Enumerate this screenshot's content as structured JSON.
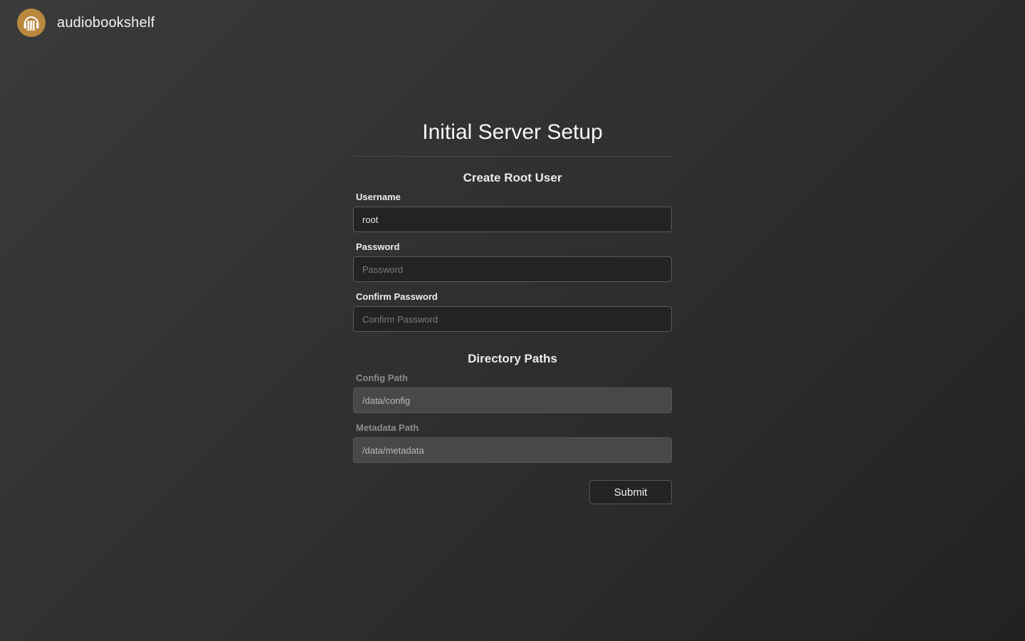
{
  "app": {
    "name": "audiobookshelf",
    "logo_icon": "audiobookshelf-logo-icon",
    "logo_color": "#b9873e"
  },
  "page": {
    "title": "Initial Server Setup"
  },
  "root_user": {
    "section_title": "Create Root User",
    "username": {
      "label": "Username",
      "value": "root",
      "placeholder": ""
    },
    "password": {
      "label": "Password",
      "value": "",
      "placeholder": "Password"
    },
    "confirm_password": {
      "label": "Confirm Password",
      "value": "",
      "placeholder": "Confirm Password"
    }
  },
  "directory_paths": {
    "section_title": "Directory Paths",
    "config_path": {
      "label": "Config Path",
      "value": "/data/config"
    },
    "metadata_path": {
      "label": "Metadata Path",
      "value": "/data/metadata"
    }
  },
  "actions": {
    "submit_label": "Submit"
  }
}
